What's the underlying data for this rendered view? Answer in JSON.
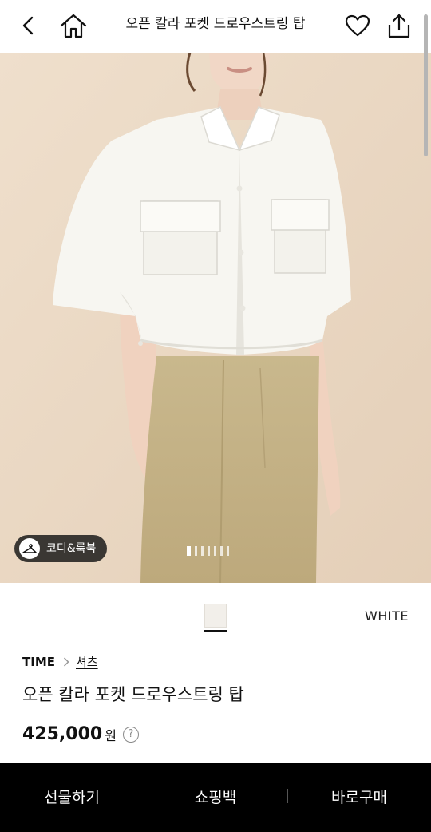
{
  "header": {
    "title": "오픈 칼라 포켓 드로우스트링 탑"
  },
  "hero": {
    "codi_label": "코디&룩북",
    "image_count": 7,
    "active_index": 0
  },
  "color": {
    "selected": "WHITE",
    "swatch": "#f2efea"
  },
  "product": {
    "brand": "TIME",
    "category": "셔츠",
    "name": "오픈 칼라 포켓 드로우스트링 탑",
    "price": "425,000",
    "currency": "원",
    "help_icon": "?"
  },
  "bottom_bar": {
    "gift": "선물하기",
    "cart": "쇼핑백",
    "buy": "바로구매"
  },
  "icons": [
    "back-icon",
    "home-icon",
    "heart-icon",
    "share-icon",
    "hanger-icon",
    "chevron-right-icon",
    "question-icon"
  ]
}
